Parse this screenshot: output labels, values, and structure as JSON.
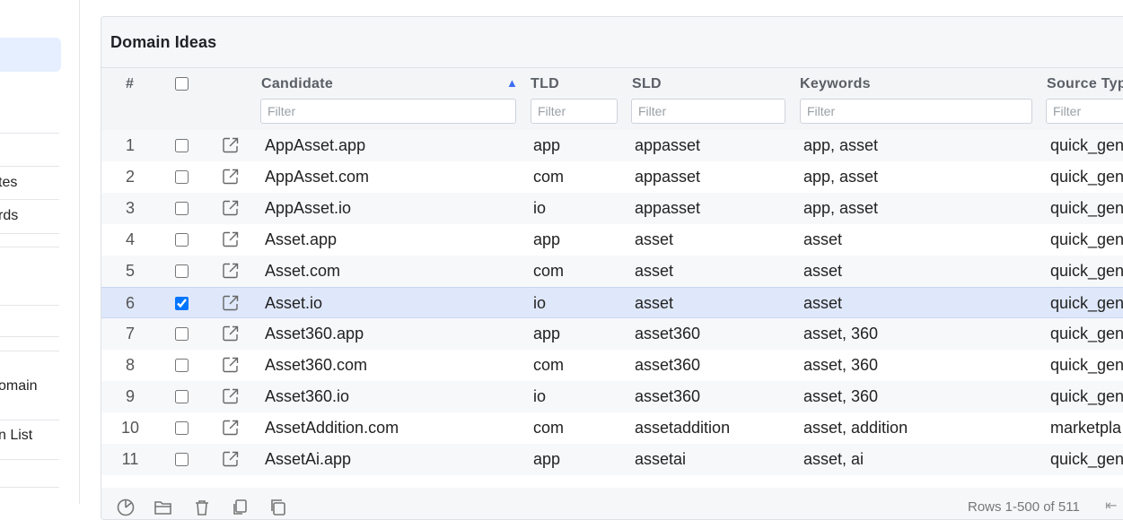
{
  "sidebar": {
    "items": [
      {
        "label": "tes"
      },
      {
        "label": "rds"
      },
      {
        "label": "omain"
      },
      {
        "label": "n List"
      }
    ]
  },
  "panel": {
    "title": "Domain Ideas"
  },
  "grid": {
    "columns": {
      "index": "#",
      "candidate": "Candidate",
      "tld": "TLD",
      "sld": "SLD",
      "keywords": "Keywords",
      "source_type": "Source Typ"
    },
    "filter_placeholder": "Filter",
    "sort": {
      "column": "Candidate",
      "direction": "ascending"
    },
    "rows": [
      {
        "num": "1",
        "candidate": "AppAsset.app",
        "tld": "app",
        "sld": "appasset",
        "keywords": "app, asset",
        "source": "quick_gen",
        "checked": false
      },
      {
        "num": "2",
        "candidate": "AppAsset.com",
        "tld": "com",
        "sld": "appasset",
        "keywords": "app, asset",
        "source": "quick_gen",
        "checked": false
      },
      {
        "num": "3",
        "candidate": "AppAsset.io",
        "tld": "io",
        "sld": "appasset",
        "keywords": "app, asset",
        "source": "quick_gen",
        "checked": false
      },
      {
        "num": "4",
        "candidate": "Asset.app",
        "tld": "app",
        "sld": "asset",
        "keywords": "asset",
        "source": "quick_gen",
        "checked": false
      },
      {
        "num": "5",
        "candidate": "Asset.com",
        "tld": "com",
        "sld": "asset",
        "keywords": "asset",
        "source": "quick_gen",
        "checked": false
      },
      {
        "num": "6",
        "candidate": "Asset.io",
        "tld": "io",
        "sld": "asset",
        "keywords": "asset",
        "source": "quick_gen",
        "checked": true
      },
      {
        "num": "7",
        "candidate": "Asset360.app",
        "tld": "app",
        "sld": "asset360",
        "keywords": "asset, 360",
        "source": "quick_gen",
        "checked": false
      },
      {
        "num": "8",
        "candidate": "Asset360.com",
        "tld": "com",
        "sld": "asset360",
        "keywords": "asset, 360",
        "source": "quick_gen",
        "checked": false
      },
      {
        "num": "9",
        "candidate": "Asset360.io",
        "tld": "io",
        "sld": "asset360",
        "keywords": "asset, 360",
        "source": "quick_gen",
        "checked": false
      },
      {
        "num": "10",
        "candidate": "AssetAddition.com",
        "tld": "com",
        "sld": "assetaddition",
        "keywords": "asset, addition",
        "source": "marketpla",
        "checked": false
      },
      {
        "num": "11",
        "candidate": "AssetAi.app",
        "tld": "app",
        "sld": "assetai",
        "keywords": "asset, ai",
        "source": "quick_gen",
        "checked": false
      }
    ]
  },
  "footer": {
    "status": "Rows 1-500 of 511",
    "icons": [
      "chart-icon",
      "folder-open-icon",
      "trash-icon",
      "copy-icon",
      "duplicate-icon"
    ]
  },
  "colors": {
    "accent": "#3d6df2",
    "selected_row": "#dfe8fa",
    "sidebar_active": "#e6efff"
  }
}
